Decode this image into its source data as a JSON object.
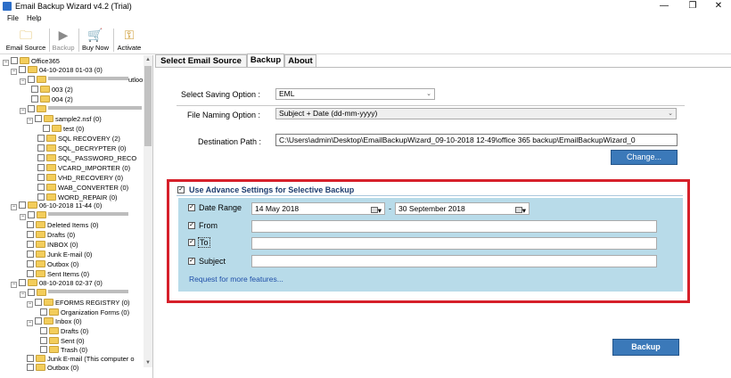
{
  "window": {
    "title": "Email Backup Wizard v4.2 (Trial)",
    "minimize": "—",
    "restore": "❐",
    "close": "✕"
  },
  "menu": {
    "file": "File",
    "help": "Help"
  },
  "toolbar": {
    "email_source": "Email Source",
    "backup": "Backup",
    "buy_now": "Buy Now",
    "activate": "Activate"
  },
  "tree": {
    "root": "Office365",
    "items": [
      "04-10-2018 01-03 (0)",
      "003 (2)",
      "004 (2)",
      "sample2.nsf (0)",
      "test (0)",
      "SQL RECOVERY (2)",
      "SQL_DECRYPTER (0)",
      "SQL_PASSWORD_RECO",
      "VCARD_IMPORTER (0)",
      "VHD_RECOVERY (0)",
      "WAB_CONVERTER (0)",
      "WORD_REPAIR (0)",
      "06-10-2018 11-44 (0)",
      "Deleted Items (0)",
      "Drafts (0)",
      "INBOX (0)",
      "Junk E-mail (0)",
      "Outbox (0)",
      "Sent Items (0)",
      "08-10-2018 02-37 (0)",
      "EFORMS REGISTRY (0)",
      "Organization Forms (0)",
      "Inbox (0)",
      "Drafts (0)",
      "Sent (0)",
      "Trash (0)",
      "Junk E-mail (This computer o",
      "Outbox (0)"
    ],
    "partial_suffix": "utloo"
  },
  "tabs": {
    "select_source": "Select Email Source",
    "backup": "Backup",
    "about": "About"
  },
  "backup": {
    "saving_option_label": "Select Saving Option :",
    "saving_option_value": "EML",
    "naming_option_label": "File Naming Option :",
    "naming_option_value": "Subject + Date (dd-mm-yyyy)",
    "destination_label": "Destination Path :",
    "destination_value": "C:\\Users\\admin\\Desktop\\EmailBackupWizard_09-10-2018 12-49\\office 365 backup\\EmailBackupWizard_0",
    "change_button": "Change...",
    "advance_label": "Use Advance Settings for Selective Backup",
    "date_range_label": "Date Range",
    "date_from": "14     May      2018",
    "date_sep": "-",
    "date_to": "30 September 2018",
    "from_label": "From",
    "to_label": "To",
    "subject_label": "Subject",
    "more_features_link": "Request for more features...",
    "backup_button": "Backup"
  },
  "colors": {
    "accent_button": "#3b79b9",
    "highlight_box": "#d6202a",
    "panel": "#b8dbe9"
  }
}
